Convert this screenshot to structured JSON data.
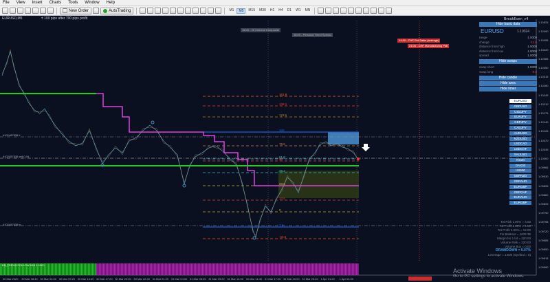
{
  "menu": [
    "File",
    "View",
    "Insert",
    "Charts",
    "Tools",
    "Window",
    "Help"
  ],
  "toolbar": {
    "new_order": "New Order",
    "autotrading": "AutoTrading",
    "timeframes": [
      "M1",
      "M5",
      "M15",
      "M30",
      "H1",
      "H4",
      "D1",
      "W1",
      "MN"
    ],
    "active_tf": "M5"
  },
  "chart": {
    "symbol_label": "EURUSD,M5",
    "info_text": "± 100 pips after 700 pips profit",
    "hline_labels": [
      "#102487838 tl",
      "#102487838 sell 0.04",
      "#102487838 tp"
    ],
    "indicator_label": "BB_TREND FOLLOW M15 1.0000",
    "x_labels": [
      "30 Mar 2020",
      "30 Mar 08:40",
      "30 Mar 04:00",
      "30 Mar 09:20",
      "30 Mar 14:40",
      "30 Mar 17:20",
      "30 Mar 20:00",
      "30 Mar 22:40",
      "31 Mar 01:20",
      "31 Mar 04:00",
      "31 Mar 06:40",
      "31 Mar 09:20",
      "31 Mar 12:00",
      "31 Mar 14:40",
      "31 Mar 17:20",
      "31 Mar 20:00",
      "31 Mar 22:40",
      "1 Apr 01:20",
      "1 Apr 04:00"
    ],
    "y_labels": [
      "1.10525",
      "1.10490",
      "1.10455",
      "1.10420",
      "1.10385",
      "1.10350",
      "1.10315",
      "1.10280",
      "1.10245",
      "1.10210",
      "1.10175",
      "1.10140",
      "1.10105",
      "1.10070",
      "1.10035",
      "1.10000",
      "1.09965",
      "1.09930",
      "1.09895",
      "1.09860",
      "1.09825",
      "1.09790",
      "1.09755",
      "1.09720",
      "1.09685",
      "1.09650",
      "1.09615",
      "1.09580"
    ],
    "fib_labels": [
      {
        "text": "161.8",
        "color": "#ff6020"
      },
      {
        "text": "138.2",
        "color": "#ff3030"
      },
      {
        "text": "123.6",
        "color": "#c08020"
      },
      {
        "text": "100",
        "color": "#2060e0"
      },
      {
        "text": "78.6",
        "color": "#d08040"
      },
      {
        "text": "61.8",
        "color": "#40c0e0"
      },
      {
        "text": "50",
        "color": "#ff4040"
      },
      {
        "text": "38.2",
        "color": "#20c0c0"
      },
      {
        "text": "23.6",
        "color": "#c0c020"
      },
      {
        "text": "14.6",
        "color": "#e04020"
      },
      {
        "text": "0",
        "color": "#d0a020"
      },
      {
        "text": "7.8",
        "color": "#2060e0"
      },
      {
        "text": "-23.6",
        "color": "#ff5020"
      }
    ],
    "grey_tags": [
      "16:00 - 25 Chinese Composite",
      "18:00 - Personal Trend Spread"
    ],
    "red_tags": [
      "14:30 - CHF Ret Sales (average)",
      "21:00 - CHF Manufacturing PMI"
    ]
  },
  "panel": {
    "title": "BreakEven_v4",
    "hide_basic": "Hide basic data",
    "symbol": "EURUSD",
    "symbol_price": "1.10324",
    "rows": [
      {
        "label": "range",
        "value": "1.0000"
      },
      {
        "label": "change",
        "value": "-11.8",
        "red": true
      },
      {
        "label": "distance from high",
        "value": "1.0000"
      },
      {
        "label": "distance from low",
        "value": "1.0000"
      },
      {
        "label": "spread",
        "value": "1.0000"
      }
    ],
    "hide_swaps": "Hide swaps",
    "swap_rows": [
      {
        "label": "swap short",
        "value": "1.0000"
      },
      {
        "label": "swap long",
        "value": "-9.0",
        "red": true
      }
    ],
    "hide_candle": "Hide candle",
    "hide_area": "Hide area",
    "hide_timer": "Hide timer",
    "pairs": [
      "EURUSD",
      "GBPUSD",
      "USDJPY",
      "EURJPY",
      "GBPJPY",
      "CADJPY",
      "AUDUSD",
      "NZDUSD",
      "USDCAD",
      "USDCHF",
      "XAUUSD",
      "NG20",
      "DAX30",
      "US500",
      "GBPNZD",
      "GBPAUD",
      "EURGBP",
      "GBPCHF",
      "EURAUD",
      "EURGBP"
    ],
    "active_pair": "EURUSD"
  },
  "stats": {
    "lines": [
      "Tot Risk 1.00% = 4.00",
      "Tot Profit 1.00% = 4.00",
      "Tot Profit 3.00% = 12.00",
      "Fin Balance = 1632.36",
      "Margin for 1 lot = 220.00",
      "Volume Risk = 220.00",
      "Volume Buy = 0.00"
    ],
    "drawdown": "DRAWDOWN = 0.07%",
    "leverage": "Leverage = 1:500 (Symbol = 0)"
  },
  "watermark": {
    "line1": "Activate Windows",
    "line2": "Go to PC settings to activate Windows."
  },
  "colors": {
    "bg": "#0a1020",
    "green_line": "#20d020",
    "magenta_line": "#e040e0",
    "blue_box": "#4a90d0"
  }
}
